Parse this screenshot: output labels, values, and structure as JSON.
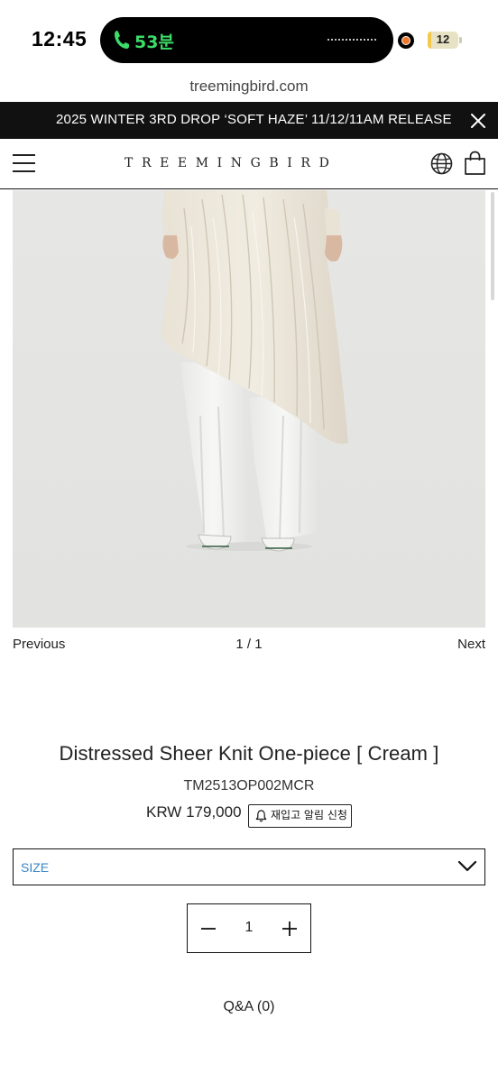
{
  "status_bar": {
    "time": "12:45",
    "call_label": "53분",
    "battery_level": "12",
    "battery_fraction": 0.12,
    "call_color": "#3ddc68",
    "recording_color": "#f0782a"
  },
  "browser": {
    "url": "treemingbird.com"
  },
  "announcement": {
    "text": "2025 WINTER 3RD DROP ‘SOFT HAZE’ 11/12/11AM RELEASE",
    "close_icon": "close-icon"
  },
  "header": {
    "logo": "TREEMINGBIRD",
    "menu_icon": "hamburger-menu-icon",
    "globe_icon": "globe-icon",
    "bag_icon": "shopping-bag-icon"
  },
  "gallery": {
    "previous_label": "Previous",
    "counter": "1 / 1",
    "next_label": "Next"
  },
  "product": {
    "title": "Distressed Sheer Knit One-piece [ Cream ]",
    "sku": "TM2513OP002MCR",
    "price": "KRW 179,000",
    "restock_label": "재입고 알림 신청",
    "size_label": "SIZE",
    "quantity": "1",
    "qa_label": "Q&A (0)"
  },
  "colors": {
    "accent_text": "#3a86c8",
    "announcement_bg": "#111111"
  }
}
